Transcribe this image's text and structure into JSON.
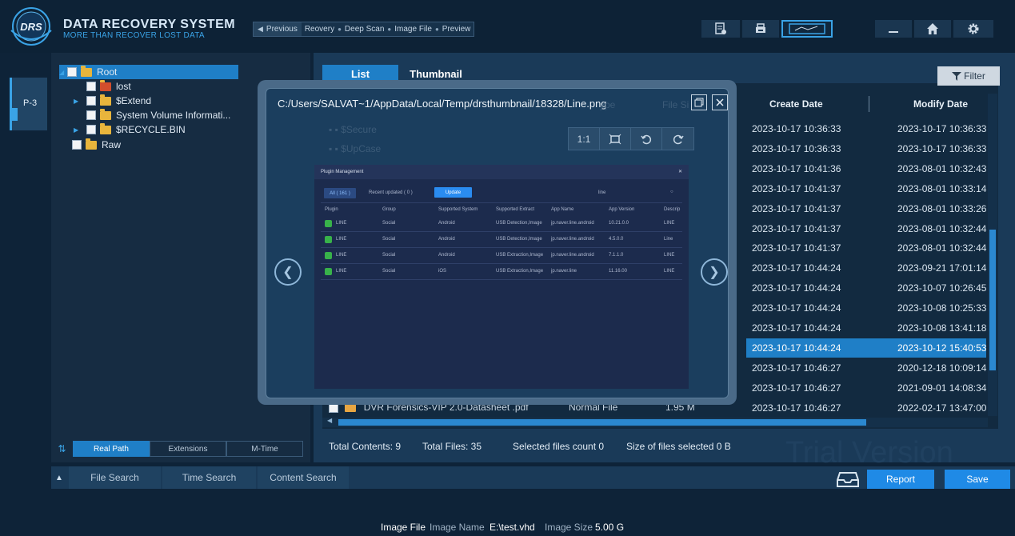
{
  "brand": {
    "logo_text": "DRS",
    "title": "DATA RECOVERY SYSTEM",
    "subtitle": "MORE THAN RECOVER LOST DATA"
  },
  "breadcrumb": {
    "previous": "Previous",
    "steps": [
      "Reovery",
      "Deep Scan",
      "Image File",
      "Preview"
    ]
  },
  "toolbar": {
    "icons": [
      "report-list-icon",
      "printer-icon",
      "monitor-icon",
      "minimize-icon",
      "home-icon",
      "gear-icon"
    ]
  },
  "partition_tab": "P-3",
  "tree": [
    {
      "label": "Root"
    },
    {
      "label": "lost"
    },
    {
      "label": "$Extend"
    },
    {
      "label": "System Volume Informati..."
    },
    {
      "label": "$RECYCLE.BIN"
    },
    {
      "label": "Raw"
    }
  ],
  "sort_tabs": [
    "Real Path",
    "Extensions",
    "M-Time"
  ],
  "view_tabs": [
    "List",
    "Thumbnail"
  ],
  "filter_label": "Filter",
  "columns": {
    "type_partial": "ype",
    "size_partial": "File Si",
    "create": "Create Date",
    "modify": "Modify Date"
  },
  "rows": [
    {
      "create": "2023-10-17 10:36:33",
      "modify": "2023-10-17 10:36:33"
    },
    {
      "create": "2023-10-17 10:36:33",
      "modify": "2023-10-17 10:36:33"
    },
    {
      "create": "2023-10-17 10:41:36",
      "modify": "2023-08-01 10:32:43"
    },
    {
      "create": "2023-10-17 10:41:37",
      "modify": "2023-08-01 10:33:14"
    },
    {
      "create": "2023-10-17 10:41:37",
      "modify": "2023-08-01 10:33:26"
    },
    {
      "create": "2023-10-17 10:41:37",
      "modify": "2023-08-01 10:32:44"
    },
    {
      "create": "2023-10-17 10:41:37",
      "modify": "2023-08-01 10:32:44"
    },
    {
      "create": "2023-10-17 10:44:24",
      "modify": "2023-09-21 17:01:14"
    },
    {
      "create": "2023-10-17 10:44:24",
      "modify": "2023-10-07 10:26:45"
    },
    {
      "create": "2023-10-17 10:44:24",
      "modify": "2023-10-08 10:25:33"
    },
    {
      "create": "2023-10-17 10:44:24",
      "modify": "2023-10-08 13:41:18"
    },
    {
      "create": "2023-10-17 10:44:24",
      "modify": "2023-10-12 15:40:53",
      "selected": true
    },
    {
      "create": "2023-10-17 10:46:27",
      "modify": "2020-12-18 10:09:14"
    },
    {
      "create": "2023-10-17 10:46:27",
      "modify": "2021-09-01 14:08:34"
    },
    {
      "create": "2023-10-17 10:46:27",
      "modify": "2022-02-17 13:47:00"
    }
  ],
  "last_row": {
    "name": "DVR Forensics-VIP 2.0-Datasheet .pdf",
    "type": "Normal File",
    "size": "1.95 M"
  },
  "ghost_rows": [
    "$Secure",
    "$UpCase"
  ],
  "summary": {
    "total_contents": "Total Contents: 9",
    "total_files": "Total Files: 35",
    "selected_count": "Selected files count  0",
    "selected_size": "Size of files  selected  0 B"
  },
  "watermark": "Trial Version",
  "search_tabs": [
    "File Search",
    "Time Search",
    "Content Search"
  ],
  "actions": {
    "report": "Report",
    "save": "Save"
  },
  "status": {
    "image_file_label": "Image File",
    "image_name_label": "Image Name",
    "image_name_value": "E:\\test.vhd",
    "image_size_label": "Image Size",
    "image_size_value": "5.00 G"
  },
  "preview": {
    "path": "C:/Users/SALVAT~1/AppData/Local/Temp/drsthumbnail/18328/Line.png",
    "zoom_label": "1:1",
    "image": {
      "title": "Plugin Management",
      "tab_all": "All ( 161 )",
      "tab_recent": "Recent updated ( 0 )",
      "update_btn": "Update",
      "search_text": "line",
      "headers": [
        "Plugin",
        "Group",
        "Supported System",
        "Supported Extract",
        "App Name",
        "App Version",
        "Descrip"
      ],
      "rows": [
        [
          "LINE",
          "Social",
          "Android",
          "USB Detection,Image",
          "jp.naver.line.android",
          "10.21.0.0",
          "LINE"
        ],
        [
          "LINE",
          "Social",
          "Android",
          "USB Detection,Image",
          "jp.naver.line.android",
          "4.5.0.0",
          "Line"
        ],
        [
          "LINE",
          "Social",
          "Android",
          "USB Extraction,Image",
          "jp.naver.line.android",
          "7.1.1.0",
          "LINE"
        ],
        [
          "LINE",
          "Social",
          "iOS",
          "USB Extraction,Image",
          "jp.naver.line",
          "11.16.00",
          "LINE"
        ]
      ]
    }
  },
  "colors": {
    "accent": "#1f7fc7",
    "button": "#1f8ae6",
    "folder": "#e8b53c",
    "background": "#0e2338"
  }
}
